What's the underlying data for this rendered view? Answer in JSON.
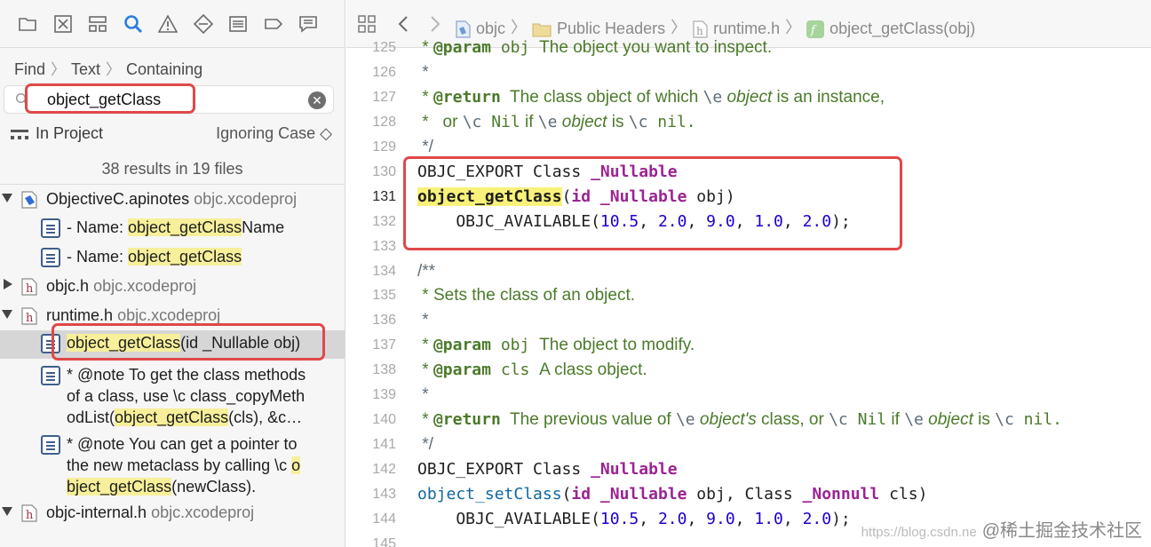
{
  "navigator": {
    "find_path": [
      "Find",
      "Text",
      "Containing"
    ],
    "search_value": "object_getClass",
    "clear_glyph": "✕",
    "scope": "In Project",
    "case_mode": "Ignoring Case ◇",
    "results_count": "38 results in 19 files",
    "files": [
      {
        "name": "ObjectiveC.apinotes",
        "project": "objc.xcodeproj",
        "icon": "apinotes-icon"
      },
      {
        "name": "objc.h",
        "project": "objc.xcodeproj",
        "icon": "header-file-icon"
      },
      {
        "name": "runtime.h",
        "project": "objc.xcodeproj",
        "icon": "header-file-icon"
      },
      {
        "name": "objc-internal.h",
        "project": "objc.xcodeproj",
        "icon": "header-file-icon"
      }
    ],
    "matches": {
      "m1_pre": "- Name: ",
      "m1_hl": "object_getClass",
      "m1_post": "Name",
      "m2_pre": "- Name: ",
      "m2_hl": "object_getClass",
      "m3_hl": "object_getClass",
      "m3_post": "(id _Nullable obj)",
      "m4_line1": "* @note To get the class methods",
      "m4_line2": "of a class, use \\c class_copyMeth",
      "m4_line3_pre": "odList(",
      "m4_line3_hl": "object_getClass",
      "m4_line3_post": "(cls), &c…",
      "m5_line1_pre": "* @note You can get a pointer to",
      "m5_line2_pre": "the new metaclass by calling \\c ",
      "m5_line2_hl": "o",
      "m5_line3_hl": "bject_getClass",
      "m5_line3_post": "(newClass)."
    }
  },
  "breadcrumbs": [
    "objc",
    "Public Headers",
    "runtime.h",
    "object_getClass(obj)"
  ],
  "editor": {
    "line_numbers": [
      "125",
      "126",
      "127",
      "128",
      "129",
      "130",
      "131",
      "132",
      "133",
      "134",
      "135",
      "136",
      "137",
      "138",
      "139",
      "140",
      "141",
      "142",
      "143",
      "144",
      "145"
    ],
    "current_line": "131",
    "l125_a": " * ",
    "l125_kw": "@param",
    "l125_b": " obj ",
    "l125_c": "The object you want to inspect.",
    "l126": " *",
    "l127_a": " * ",
    "l127_kw": "@return",
    "l127_b": "  The class object of which ",
    "l127_c": "\\e",
    "l127_d": " object",
    "l127_e": " is an instance,",
    "l128_a": " *   or ",
    "l128_b": "\\c",
    "l128_c": " Nil",
    "l128_d": " if ",
    "l128_e": "\\e",
    "l128_f": " object",
    "l128_g": " is ",
    "l128_h": "\\c",
    "l128_i": " nil.",
    "l129": " */",
    "l130_a": "OBJC_EXPORT ",
    "l130_b": "Class ",
    "l130_c": "_Nullable",
    "l131_a": "object_getClass",
    "l131_b": "(",
    "l131_c": "id ",
    "l131_d": "_Nullable",
    "l131_e": " obj)",
    "l132_a": "    OBJC_AVAILABLE(",
    "l132_n1": "10.5",
    "l132_n2": "2.0",
    "l132_n3": "9.0",
    "l132_n4": "1.0",
    "l132_n5": "2.0",
    "l132_sep": ", ",
    "l132_end": ");",
    "l134": "/**",
    "l135_a": " * ",
    "l135_b": "Sets the class of an object.",
    "l136": " *",
    "l137_a": " * ",
    "l137_kw": "@param",
    "l137_b": " obj ",
    "l137_c": "The object to modify.",
    "l138_a": " * ",
    "l138_kw": "@param",
    "l138_b": " cls ",
    "l138_c": "A class object.",
    "l139": " *",
    "l140_a": " * ",
    "l140_kw": "@return",
    "l140_b": "  The previous value of ",
    "l140_c": "\\e",
    "l140_d": " object's",
    "l140_e": " class, or ",
    "l140_f": "\\c",
    "l140_g": " Nil",
    "l140_h": " if ",
    "l140_i": "\\e",
    "l140_j": " object",
    "l140_k": " is ",
    "l140_l": "\\c",
    "l140_m": " nil.",
    "l141": " */",
    "l142_a": "OBJC_EXPORT ",
    "l142_b": "Class ",
    "l142_c": "_Nullable",
    "l143_a": "object_setClass",
    "l143_b": "(",
    "l143_c": "id ",
    "l143_d": "_Nullable",
    "l143_e": " obj, ",
    "l143_f": "Class ",
    "l143_g": "_Nonnull",
    "l143_h": " cls)",
    "l144_a": "    OBJC_AVAILABLE(",
    "l144_n1": "10.5",
    "l144_n2": "2.0",
    "l144_n3": "9.0",
    "l144_n4": "1.0",
    "l144_n5": "2.0",
    "l144_sep": ", ",
    "l144_end": ");"
  },
  "watermark": {
    "url": "https://blog.csdn.ne",
    "brand": "@稀土掘金技术社区"
  },
  "colors": {
    "highlight_box": "#e04848",
    "match_highlight": "#f7ef9a",
    "keyword": "#9b2393",
    "number": "#1c00cf",
    "doc_comment": "#4b7a2a"
  }
}
